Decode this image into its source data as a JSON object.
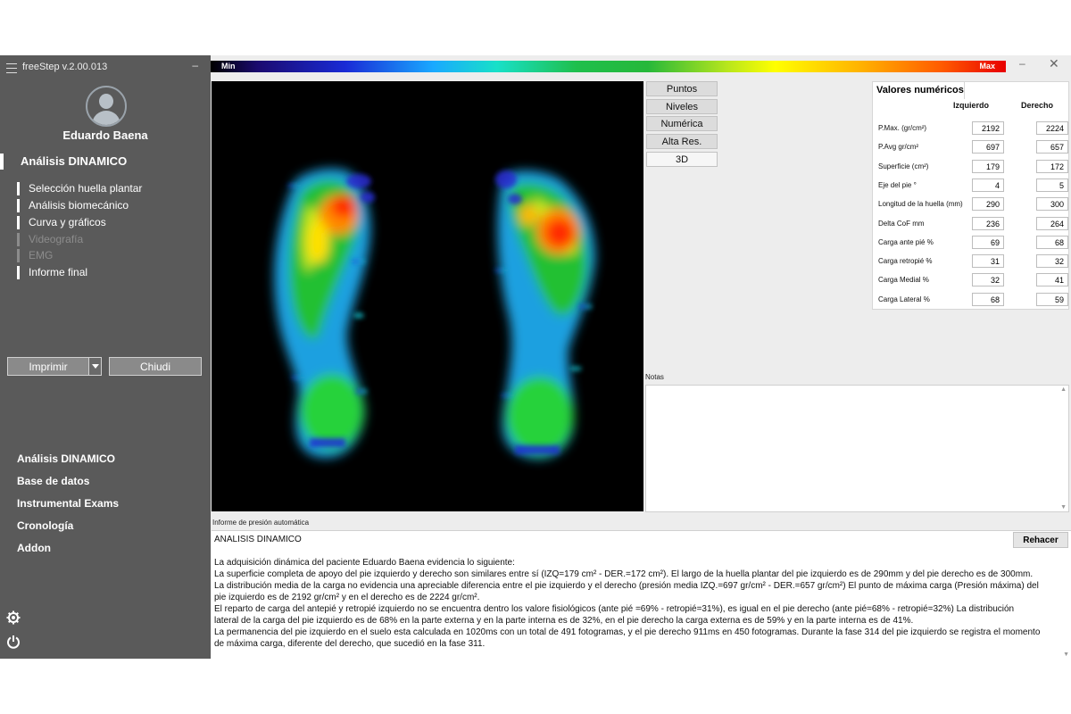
{
  "app": {
    "title": "freeStep v.2.00.013",
    "minimize": "–"
  },
  "user": {
    "name": "Eduardo Baena"
  },
  "sidebar": {
    "section_title": "Análisis DINAMICO",
    "items": [
      {
        "label": "Selección huella plantar",
        "enabled": true
      },
      {
        "label": "Análisis biomecánico",
        "enabled": true
      },
      {
        "label": "Curva y gráficos",
        "enabled": true
      },
      {
        "label": "Videografía",
        "enabled": false
      },
      {
        "label": "EMG",
        "enabled": false
      },
      {
        "label": "Informe final",
        "enabled": true
      }
    ],
    "print_button": "Imprimir",
    "close_button": "Chiudi",
    "nav": [
      {
        "label": "Análisis DINAMICO"
      },
      {
        "label": "Base de datos"
      },
      {
        "label": "Instrumental Exams"
      },
      {
        "label": "Cronología"
      },
      {
        "label": "Addon"
      }
    ],
    "icons": [
      "gear-icon",
      "power-icon"
    ]
  },
  "colorbar": {
    "min_label": "Min",
    "max_label": "Max"
  },
  "window": {
    "minimize": "–",
    "close": "✕"
  },
  "view_buttons": [
    {
      "label": "Puntos",
      "active": false
    },
    {
      "label": "Niveles",
      "active": false
    },
    {
      "label": "Numérica",
      "active": false
    },
    {
      "label": "Alta Res.",
      "active": false
    },
    {
      "label": "3D",
      "active": true
    }
  ],
  "values_panel": {
    "title": "Valores numéricos",
    "left_header": "Izquierdo",
    "right_header": "Derecho",
    "rows": [
      {
        "label": "P.Max. (gr/cm²)",
        "left": "2192",
        "right": "2224"
      },
      {
        "label": "P.Avg gr/cm²",
        "left": "697",
        "right": "657"
      },
      {
        "label": "Superficie (cm²)",
        "left": "179",
        "right": "172"
      },
      {
        "label": "Eje del pie °",
        "left": "4",
        "right": "5"
      },
      {
        "label": "Longitud de la huella (mm)",
        "left": "290",
        "right": "300"
      },
      {
        "label": "Delta CoF mm",
        "left": "236",
        "right": "264"
      },
      {
        "label": "Carga ante pié %",
        "left": "69",
        "right": "68"
      },
      {
        "label": "Carga retropié %",
        "left": "31",
        "right": "32"
      },
      {
        "label": "Carga Medial %",
        "left": "32",
        "right": "41"
      },
      {
        "label": "Carga Lateral %",
        "left": "68",
        "right": "59"
      }
    ]
  },
  "notes": {
    "label": "Notas",
    "value": ""
  },
  "report": {
    "label": "Informe de presión automática",
    "redo_button": "Rehacer",
    "lines": [
      "ANALISIS DINAMICO",
      "",
      "La adquisición dinámica del paciente Eduardo Baena evidencia lo siguiente:",
      "La superficie completa de apoyo del pie izquierdo y derecho son similares entre sí (IZQ=179 cm² - DER.=172 cm²). El largo de la huella plantar del pie izquierdo es de 290mm y del pie derecho es de 300mm.",
      "La distribución media de la carga no evidencia una apreciable diferencia entre el pie izquierdo y el derecho (presión media IZQ.=697 gr/cm² - DER.=657 gr/cm²) El punto de máxima carga (Presión máxima) del",
      "pie izquierdo es de 2192 gr/cm² y en el derecho es de 2224 gr/cm².",
      "El reparto de carga del antepié y retropié izquierdo no se encuentra dentro los valore fisiológicos (ante pié =69% - retropié=31%), es igual en el pie derecho (ante pié=68% - retropié=32%) La distribución",
      "lateral de la carga  del pie izquierdo es de 68%  en la parte externa y en la parte interna es de 32%, en el pie derecho la carga externa es de 59% y en la parte interna es de 41%.",
      "La permanencia del pie izquierdo en el suelo esta calculada en 1020ms con un total de 491 fotogramas, y el pie derecho 911ms en 450 fotogramas. Durante la fase 314 del pie izquierdo se registra el momento",
      "de máxima carga, diferente del derecho, que sucedió en la fase 311."
    ]
  }
}
